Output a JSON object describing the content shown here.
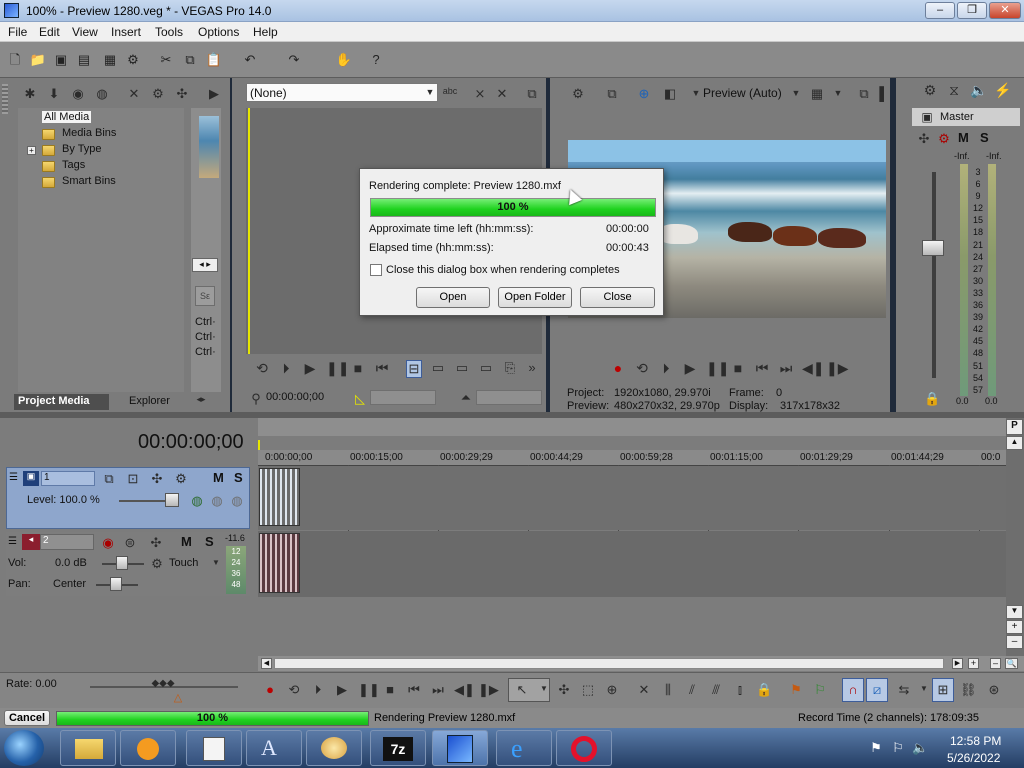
{
  "window": {
    "title": "100% - Preview 1280.veg * - VEGAS Pro 14.0",
    "min": "–",
    "max": "❐",
    "close": "✕"
  },
  "menu": [
    "File",
    "Edit",
    "View",
    "Insert",
    "Tools",
    "Options",
    "Help"
  ],
  "explorer": {
    "items": [
      "All Media",
      "Media Bins",
      "By Type",
      "Tags",
      "Smart Bins"
    ],
    "tabs": [
      "Project Media",
      "Explorer"
    ],
    "ctrl": [
      "Ctrl·",
      "Ctrl·",
      "Ctrl·"
    ]
  },
  "trimmer": {
    "dropdown": "(None)",
    "timecode": "00:00:00;00"
  },
  "preview": {
    "quality": "Preview (Auto)",
    "project_label": "Project:",
    "project_value": "1920x1080, 29.970i",
    "frame_label": "Frame:",
    "frame_value": "0",
    "preview_label": "Preview:",
    "preview_value": "480x270x32, 29.970p",
    "display_label": "Display:",
    "display_value": "317x178x32"
  },
  "master": {
    "title": "Master",
    "m": "M",
    "s": "S",
    "inf_left": "-Inf.",
    "inf_right": "-Inf.",
    "scale": [
      "3",
      "6",
      "9",
      "12",
      "15",
      "18",
      "21",
      "24",
      "27",
      "30",
      "33",
      "36",
      "39",
      "42",
      "45",
      "48",
      "51",
      "54",
      "57"
    ],
    "bottom_left": "0.0",
    "bottom_right": "0.0"
  },
  "dialog": {
    "title": "Rendering complete: Preview 1280.mxf",
    "progress_label": "100 %",
    "progress": 1.0,
    "time_left_label": "Approximate time left (hh:mm:ss):",
    "time_left": "00:00:00",
    "elapsed_label": "Elapsed time (hh:mm:ss):",
    "elapsed": "00:00:43",
    "checkbox_label": "Close this dialog box when rendering completes",
    "open": "Open",
    "open_folder": "Open Folder",
    "close": "Close"
  },
  "timeline": {
    "timecode": "00:00:00;00",
    "ruler": [
      "0:00:00;00",
      "00:00:15;00",
      "00:00:29;29",
      "00:00:44;29",
      "00:00:59;28",
      "00:01:15;00",
      "00:01:29;29",
      "00:01:44;29",
      "00:0"
    ],
    "video_track": {
      "number": "1",
      "level_label": "Level: 100.0 %",
      "m": "M",
      "s": "S"
    },
    "audio_track": {
      "number": "2",
      "vol_label": "Vol:",
      "vol_value": "0.0 dB",
      "pan_label": "Pan:",
      "pan_value": "Center",
      "touch": "Touch",
      "m": "M",
      "s": "S",
      "meter_top": "-11.6",
      "meter_scale": [
        "12",
        "24",
        "36",
        "48"
      ]
    },
    "rate": "Rate: 0.00"
  },
  "status": {
    "cancel": "Cancel",
    "progress_label": "100 %",
    "progress": 1.0,
    "rendering": "Rendering Preview 1280.mxf",
    "record_time": "Record Time (2 channels): 178:09:35"
  },
  "taskbar": {
    "time": "12:58 PM",
    "date": "5/26/2022"
  },
  "colors": {
    "accent_green": "#1fd21f",
    "track_blue": "#7e9ac2",
    "audio_red": "#8b1e2e"
  }
}
